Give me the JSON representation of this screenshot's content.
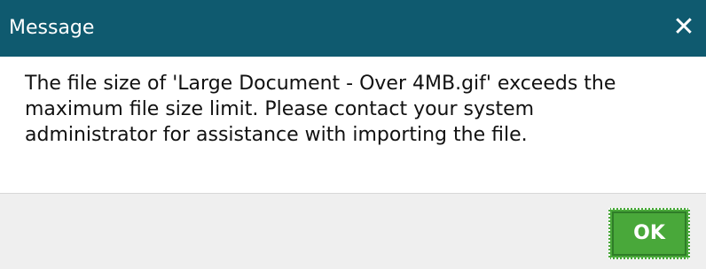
{
  "dialog": {
    "title": "Message",
    "close_icon": "close-icon",
    "message": "The file size of 'Large Document - Over 4MB.gif' exceeds the\nmaximum file size limit. Please contact your system\nadministrator for assistance with importing the file.",
    "ok_label": "OK"
  },
  "colors": {
    "titlebar": "#0f5a6f",
    "footer": "#efefef",
    "ok_button": "#49a83a"
  }
}
